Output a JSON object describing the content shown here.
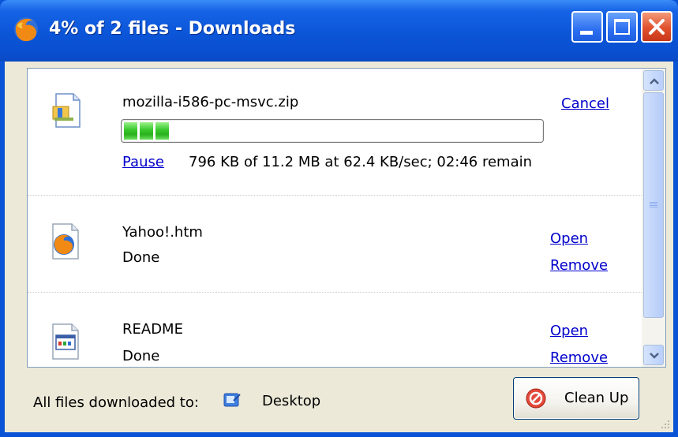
{
  "window": {
    "title": "4% of 2 files - Downloads",
    "icon": "firefox-icon",
    "controls": [
      "minimize-icon",
      "maximize-icon",
      "close-icon"
    ]
  },
  "downloads": [
    {
      "filename": "mozilla-i586-pc-msvc.zip",
      "icon": "zip-file-icon",
      "state": "downloading",
      "progress_fraction": 0.07,
      "progress_text": "796 KB of 11.2 MB at 62.4 KB/sec; 02:46 remain",
      "actions": {
        "cancel": "Cancel",
        "pause": "Pause"
      }
    },
    {
      "filename": "Yahoo!.htm",
      "icon": "firefox-document-icon",
      "status": "Done",
      "actions": {
        "open": "Open",
        "remove": "Remove"
      }
    },
    {
      "filename": "README",
      "icon": "application-document-icon",
      "status": "Done",
      "actions": {
        "open": "Open",
        "remove": "Remove"
      }
    }
  ],
  "footer": {
    "label": "All files downloaded to:",
    "folder_icon": "desktop-icon",
    "folder": "Desktop",
    "clean_up": "Clean Up"
  },
  "colors": {
    "titlebar": "#0a55d8",
    "link": "#0000cc",
    "progress": "#37c82a",
    "client_bg": "#ece9d8"
  }
}
